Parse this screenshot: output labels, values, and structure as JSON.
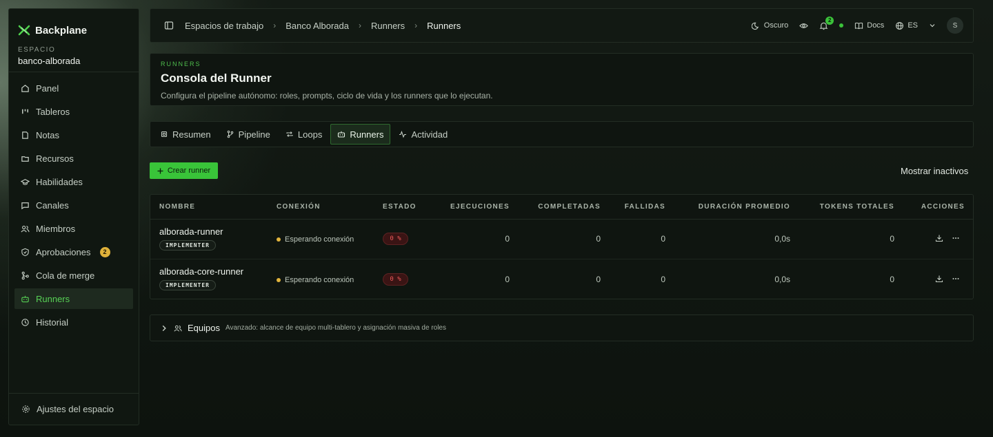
{
  "sidebar": {
    "brand": "Backplane",
    "space_label": "ESPACIO",
    "space_name": "banco-alborada",
    "items": [
      {
        "label": "Panel",
        "icon": "home-icon"
      },
      {
        "label": "Tableros",
        "icon": "kanban-icon"
      },
      {
        "label": "Notas",
        "icon": "note-icon"
      },
      {
        "label": "Recursos",
        "icon": "folder-icon"
      },
      {
        "label": "Habilidades",
        "icon": "graduation-cap-icon"
      },
      {
        "label": "Canales",
        "icon": "chat-icon"
      },
      {
        "label": "Miembros",
        "icon": "users-icon"
      },
      {
        "label": "Aprobaciones",
        "icon": "shield-check-icon",
        "badge": "2"
      },
      {
        "label": "Cola de merge",
        "icon": "merge-icon"
      },
      {
        "label": "Runners",
        "icon": "bot-icon",
        "active": true
      },
      {
        "label": "Historial",
        "icon": "history-icon"
      }
    ],
    "footer": "Ajustes del espacio"
  },
  "topbar": {
    "crumbs": [
      "Espacios de trabajo",
      "Banco Alborada",
      "Runners",
      "Runners"
    ],
    "theme_label": "Oscuro",
    "notif_count": "2",
    "docs_label": "Docs",
    "lang_label": "ES",
    "avatar_initial": "S"
  },
  "header": {
    "eyebrow": "RUNNERS",
    "title": "Consola del Runner",
    "subtitle": "Configura el pipeline autónomo: roles, prompts, ciclo de vida y los runners que lo ejecutan."
  },
  "tabs": [
    {
      "label": "Resumen",
      "icon": "cpu-icon"
    },
    {
      "label": "Pipeline",
      "icon": "git-branch-icon"
    },
    {
      "label": "Loops",
      "icon": "repeat-icon"
    },
    {
      "label": "Runners",
      "icon": "bot-icon",
      "active": true
    },
    {
      "label": "Actividad",
      "icon": "activity-icon"
    }
  ],
  "actions": {
    "create_label": "Crear runner",
    "show_inactive": "Mostrar inactivos"
  },
  "table": {
    "columns": [
      "NOMBRE",
      "CONEXIÓN",
      "ESTADO",
      "EJECUCIONES",
      "COMPLETADAS",
      "FALLIDAS",
      "DURACIÓN PROMEDIO",
      "TOKENS TOTALES",
      "ACCIONES"
    ],
    "rows": [
      {
        "name": "alborada-runner",
        "role": "IMPLEMENTER",
        "connection": "Esperando conexión",
        "state": "0 %",
        "runs": "0",
        "completed": "0",
        "failed": "0",
        "avg_duration": "0,0s",
        "tokens": "0"
      },
      {
        "name": "alborada-core-runner",
        "role": "IMPLEMENTER",
        "connection": "Esperando conexión",
        "state": "0 %",
        "runs": "0",
        "completed": "0",
        "failed": "0",
        "avg_duration": "0,0s",
        "tokens": "0"
      }
    ]
  },
  "teams": {
    "title": "Equipos",
    "description": "Avanzado: alcance de equipo multi-tablero y asignación masiva de roles"
  },
  "colors": {
    "accent": "#39c439",
    "warning": "#e2b43d",
    "danger": "#ee5a5a"
  }
}
